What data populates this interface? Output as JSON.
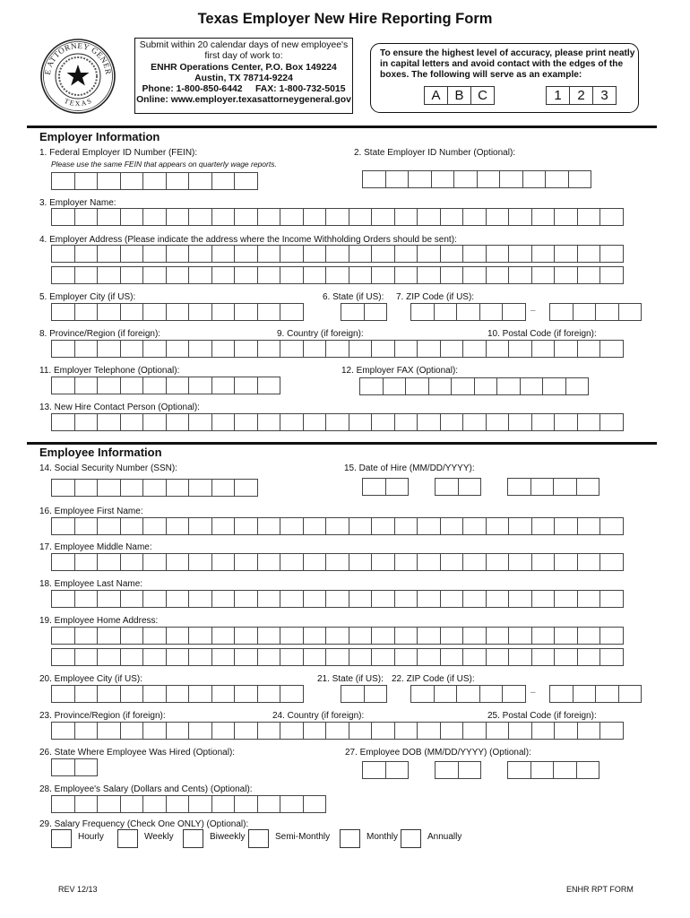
{
  "title": "Texas Employer New Hire Reporting Form",
  "seal": {
    "icon": "attorney-general-texas-seal-icon",
    "top_text": "THE ATTORNEY GENERAL",
    "bottom_text": "TEXAS"
  },
  "info_box": {
    "line1": "Submit within 20 calendar days of new employee's",
    "line2": "first day of work to:",
    "line3": "ENHR Operations Center, P.O. Box 149224",
    "line4": "Austin, TX 78714-9224",
    "line5": "Phone: 1-800-850-6442     FAX: 1-800-732-5015",
    "line6": "Online: www.employer.texasattorneygeneral.gov"
  },
  "example_box": {
    "line1": "To ensure the highest level of accuracy, please print neatly",
    "line2": "in capital letters and avoid contact with the edges of the",
    "line3": "boxes. The following will serve as an example:",
    "letters": [
      "A",
      "B",
      "C"
    ],
    "digits": [
      "1",
      "2",
      "3"
    ]
  },
  "employer": {
    "heading": "Employer Information",
    "f1": {
      "label": "1. Federal Employer ID Number (FEIN):",
      "note": "Please use the same FEIN that appears on quarterly wage reports.",
      "boxes": 9
    },
    "f2": {
      "label": "2. State Employer ID Number (Optional):",
      "boxes": 10
    },
    "f3": {
      "label": "3. Employer Name:",
      "boxes": 25
    },
    "f4": {
      "label": "4. Employer Address (Please indicate the address where the Income Withholding Orders should be sent):",
      "boxes": 25,
      "lines": 2
    },
    "f5": {
      "label": "5. Employer City (if US):",
      "boxes": 11
    },
    "f6": {
      "label": "6. State (if US):",
      "boxes": 2
    },
    "f7": {
      "label": "7. ZIP Code (if US):",
      "boxes": 5,
      "ext_boxes": 4,
      "separator": "–"
    },
    "f8": {
      "label": "8. Province/Region (if foreign):"
    },
    "f9": {
      "label": "9. Country (if foreign):"
    },
    "f10": {
      "label": "10. Postal Code (if foreign):"
    },
    "f8_10_boxes": 25,
    "f11": {
      "label": "11. Employer Telephone (Optional):",
      "boxes": 10
    },
    "f12": {
      "label": "12. Employer FAX (Optional):",
      "boxes": 10
    },
    "f13": {
      "label": "13. New Hire Contact Person (Optional):",
      "boxes": 25
    }
  },
  "employee": {
    "heading": "Employee Information",
    "f14": {
      "label": "14. Social Security Number (SSN):",
      "boxes": 9
    },
    "f15": {
      "label": "15. Date of Hire (MM/DD/YYYY):",
      "groups": [
        2,
        2,
        4
      ]
    },
    "f16": {
      "label": "16. Employee First Name:",
      "boxes": 25
    },
    "f17": {
      "label": "17. Employee Middle Name:",
      "boxes": 25
    },
    "f18": {
      "label": "18. Employee Last Name:",
      "boxes": 25
    },
    "f19": {
      "label": "19. Employee Home Address:",
      "boxes": 25,
      "lines": 2
    },
    "f20": {
      "label": "20. Employee City (if US):",
      "boxes": 11
    },
    "f21": {
      "label": "21. State (if US):",
      "boxes": 2
    },
    "f22": {
      "label": "22. ZIP Code (if US):",
      "boxes": 5,
      "ext_boxes": 4,
      "separator": "–"
    },
    "f23": {
      "label": "23. Province/Region (if foreign):"
    },
    "f24": {
      "label": "24. Country (if foreign):"
    },
    "f25": {
      "label": "25. Postal Code (if foreign):"
    },
    "f23_25_boxes": 25,
    "f26": {
      "label": "26. State Where Employee Was Hired (Optional):",
      "boxes": 2
    },
    "f27": {
      "label": "27. Employee DOB (MM/DD/YYYY) (Optional):",
      "groups": [
        2,
        2,
        4
      ]
    },
    "f28": {
      "label": "28. Employee's Salary (Dollars and Cents) (Optional):",
      "boxes": 12
    },
    "f29": {
      "label": "29. Salary Frequency (Check One ONLY) (Optional):",
      "options": [
        "Hourly",
        "Weekly",
        "Biweekly",
        "Semi-Monthly",
        "Monthly",
        "Annually"
      ]
    }
  },
  "footer": {
    "left": "REV 12/13",
    "right": "ENHR RPT FORM"
  }
}
